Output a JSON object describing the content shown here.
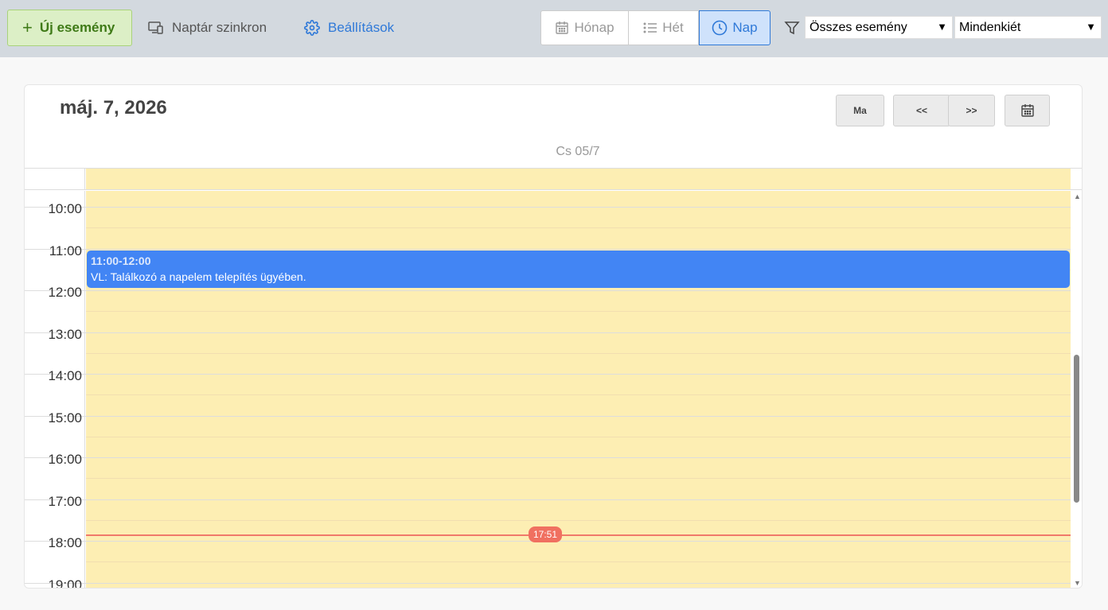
{
  "toolbar": {
    "new_event_label": "Új esemény",
    "sync_label": "Naptár szinkron",
    "settings_label": "Beállítások",
    "views": {
      "month": "Hónap",
      "week": "Hét",
      "day": "Nap",
      "active": "day"
    },
    "filter_event_type": "Összes esemény",
    "filter_owner": "Mindenkiét",
    "accent_color": "#2f79d8",
    "new_event_color": "#3f7a17"
  },
  "calendar": {
    "title": "máj. 7, 2026",
    "today_label": "Ma",
    "prev_label": "<<",
    "next_label": ">>",
    "day_header": "Cs 05/7",
    "hours": [
      "10:00",
      "11:00",
      "12:00",
      "13:00",
      "14:00",
      "15:00",
      "16:00",
      "17:00",
      "18:00",
      "19:00"
    ],
    "day_background": "#fdeeb3",
    "event": {
      "time": "11:00-12:00",
      "title": "VL: Találkozó a napelem telepítés ügyében.",
      "color": "#4285f4"
    },
    "now_label": "17:51",
    "now_color": "#f07a6a"
  }
}
